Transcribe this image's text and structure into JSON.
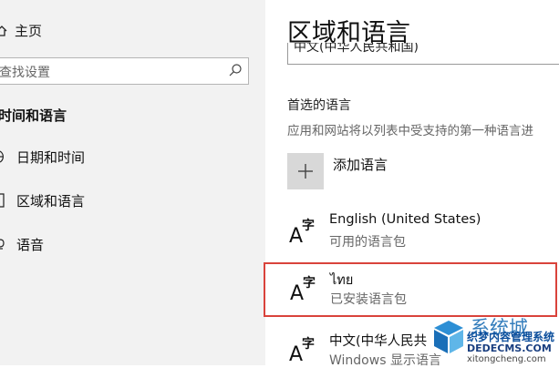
{
  "nav": {
    "home_label": "主页",
    "search_placeholder": "查找设置",
    "section_title": "时间和语言",
    "items": [
      {
        "label": "日期和时间"
      },
      {
        "label": "区域和语言"
      },
      {
        "label": "语音"
      }
    ]
  },
  "main": {
    "title": "区域和语言",
    "country_value": "中文(中华人民共和国)",
    "preferred_title": "首选的语言",
    "preferred_desc": "应用和网站将以列表中受支持的第一种语言进",
    "add_label": "添加语言",
    "languages": [
      {
        "name": "English (United States)",
        "status": "可用的语言包"
      },
      {
        "name": "ไทย",
        "status": "已安装语言包"
      },
      {
        "name": "中文(中华人民共",
        "status": "Windows 显示语言"
      }
    ]
  },
  "watermark": {
    "big": "系统城",
    "line1": "织梦内容管理系统",
    "line2": "DEDECMS.COM",
    "line3": "xitongcheng.com"
  },
  "colors": {
    "nav_bg": "#f2f2f2",
    "highlight_border": "#d9433b",
    "add_button_bg": "#d8d8d8"
  }
}
